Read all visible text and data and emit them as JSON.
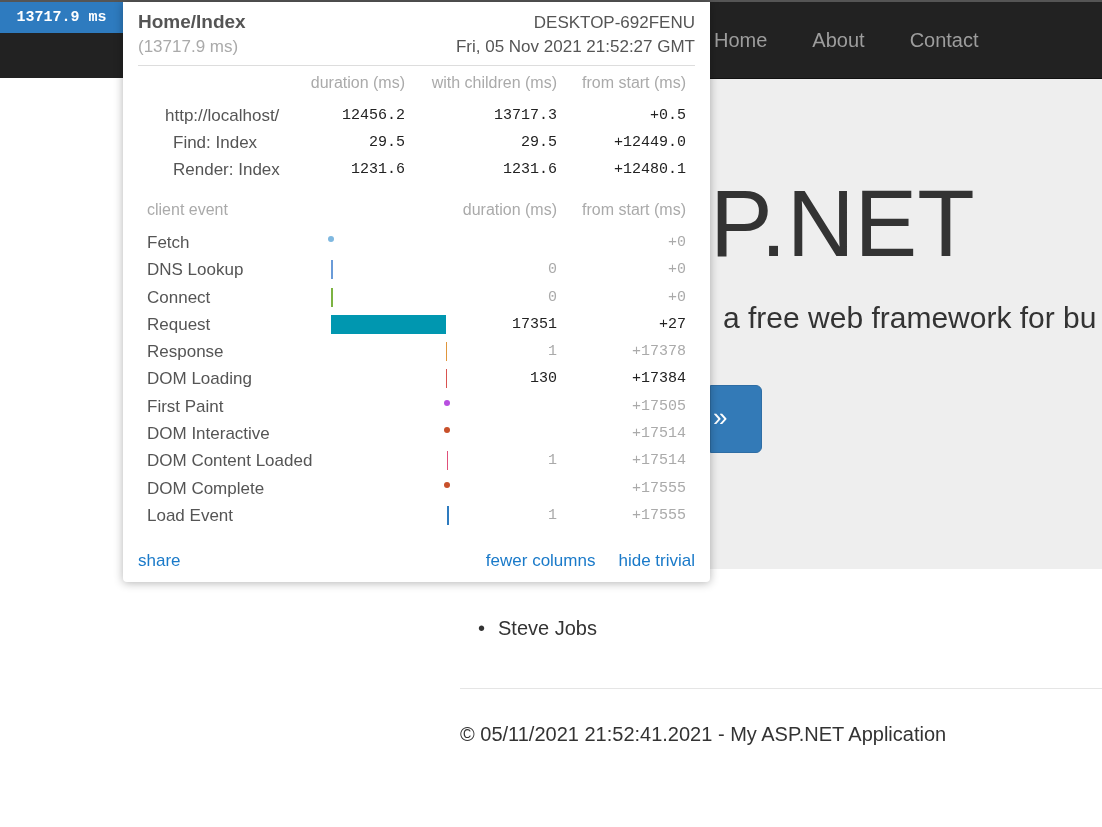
{
  "badge": {
    "text": "13717.9 ms"
  },
  "nav": [
    "Home",
    "About",
    "Contact"
  ],
  "hero": {
    "heading": "P.NET",
    "lead": "a free web framework for bu",
    "button": "»"
  },
  "list": [
    {
      "bullet": "•",
      "text": "Steve Jobs"
    }
  ],
  "footer": "© 05/11/2021 21:52:41.2021 - My ASP.NET Application",
  "profiler": {
    "title": "Home/Index",
    "machine": "DESKTOP-692FENU",
    "total": "(13717.9 ms)",
    "date": "Fri, 05 Nov 2021 21:52:27 GMT",
    "server_columns": [
      "duration (ms)",
      "with children (ms)",
      "from start (ms)"
    ],
    "server_rows": [
      {
        "name": "http://localhost/",
        "duration": "12456.2",
        "with_children": "13717.3",
        "from_start": "+0.5",
        "children": [
          {
            "name": "Find: Index",
            "duration": "29.5",
            "with_children": "29.5",
            "from_start": "+12449.0"
          },
          {
            "name": "Render: Index",
            "duration": "1231.6",
            "with_children": "1231.6",
            "from_start": "+12480.1"
          }
        ]
      }
    ],
    "client_columns": [
      "client event",
      "duration (ms)",
      "from start (ms)"
    ],
    "client_events": [
      {
        "name": "Fetch",
        "kind": "dot",
        "color": "#7fb8e0",
        "from_start": "+0",
        "trivial": true
      },
      {
        "name": "DNS Lookup",
        "kind": "line",
        "color": "#6a9bd8",
        "duration": "0",
        "from_start": "+0",
        "trivial": true
      },
      {
        "name": "Connect",
        "kind": "line",
        "color": "#7cb342",
        "duration": "0",
        "from_start": "+0",
        "trivial": true
      },
      {
        "name": "Request",
        "kind": "bar",
        "color": "#0097b0",
        "duration": "17351",
        "from_start": "+27",
        "trivial": false
      },
      {
        "name": "Response",
        "kind": "line",
        "color": "#e0963c",
        "duration": "1",
        "from_start": "+17378",
        "trivial": true
      },
      {
        "name": "DOM Loading",
        "kind": "line",
        "color": "#d9534f",
        "duration": "130",
        "from_start": "+17384",
        "trivial": false
      },
      {
        "name": "First Paint",
        "kind": "dot",
        "color": "#b84fe0",
        "from_start": "+17505",
        "trivial": true
      },
      {
        "name": "DOM Interactive",
        "kind": "dot",
        "color": "#c8502a",
        "from_start": "+17514",
        "trivial": true
      },
      {
        "name": "DOM Content Loaded",
        "kind": "line",
        "color": "#e0507a",
        "duration": "1",
        "from_start": "+17514",
        "trivial": true
      },
      {
        "name": "DOM Complete",
        "kind": "dot",
        "color": "#c8502a",
        "from_start": "+17555",
        "trivial": true
      },
      {
        "name": "Load Event",
        "kind": "line",
        "color": "#2e7bbf",
        "duration": "1",
        "from_start": "+17555",
        "trivial": true
      }
    ],
    "links": [
      "share",
      "fewer columns",
      "hide trivial"
    ]
  }
}
